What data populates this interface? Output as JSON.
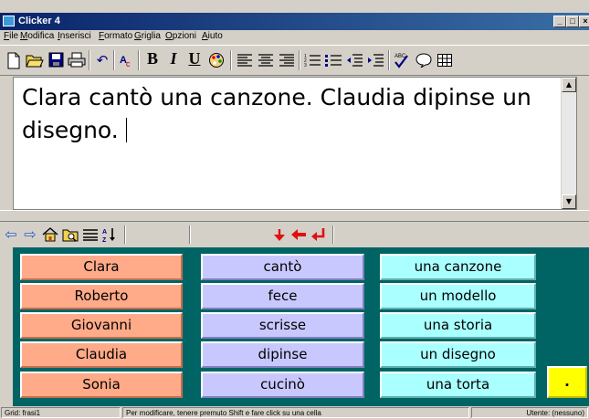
{
  "window": {
    "title": "Clicker 4",
    "controls": {
      "minimize": "_",
      "maximize": "□",
      "close": "×"
    }
  },
  "menu": [
    "File",
    "Modifica",
    "Inserisci",
    "Formato",
    "Griglia",
    "Opzioni",
    "Aiuto"
  ],
  "toolbar": {
    "icons": [
      "new-document-icon",
      "open-folder-icon",
      "save-icon",
      "print-icon",
      "undo-icon",
      "spellcheck-icon",
      "bold-icon",
      "italic-icon",
      "underline-icon",
      "color-palette-icon",
      "align-left-icon",
      "align-center-icon",
      "align-right-icon",
      "numbered-list-icon",
      "bulleted-list-icon",
      "outdent-icon",
      "indent-icon",
      "spelling-abc-icon",
      "speech-bubble-icon",
      "grid-icon"
    ],
    "bold": "B",
    "italic": "I",
    "underline": "U",
    "spell_label": "ABC"
  },
  "document": {
    "text": "Clara cantò una canzone. Claudia dipinse un disegno."
  },
  "grid": {
    "columns": {
      "names": [
        "Clara",
        "Roberto",
        "Giovanni",
        "Claudia",
        "Sonia"
      ],
      "verbs": [
        "cantò",
        "fece",
        "scrisse",
        "dipinse",
        "cucinò"
      ],
      "objects": [
        "una canzone",
        "un modello",
        "una storia",
        "un disegno",
        "una torta"
      ],
      "punctuation": "."
    },
    "colors": {
      "background": "#006464",
      "names": "#ffaa88",
      "verbs": "#c8c8ff",
      "objects": "#aaffff",
      "punctuation": "#ffff00"
    }
  },
  "status": {
    "grid": "Grid: frasi1",
    "hint": "Per modificare, tenere premuto Shift e fare click su una cella",
    "user": "Utente: (nessuno)"
  }
}
